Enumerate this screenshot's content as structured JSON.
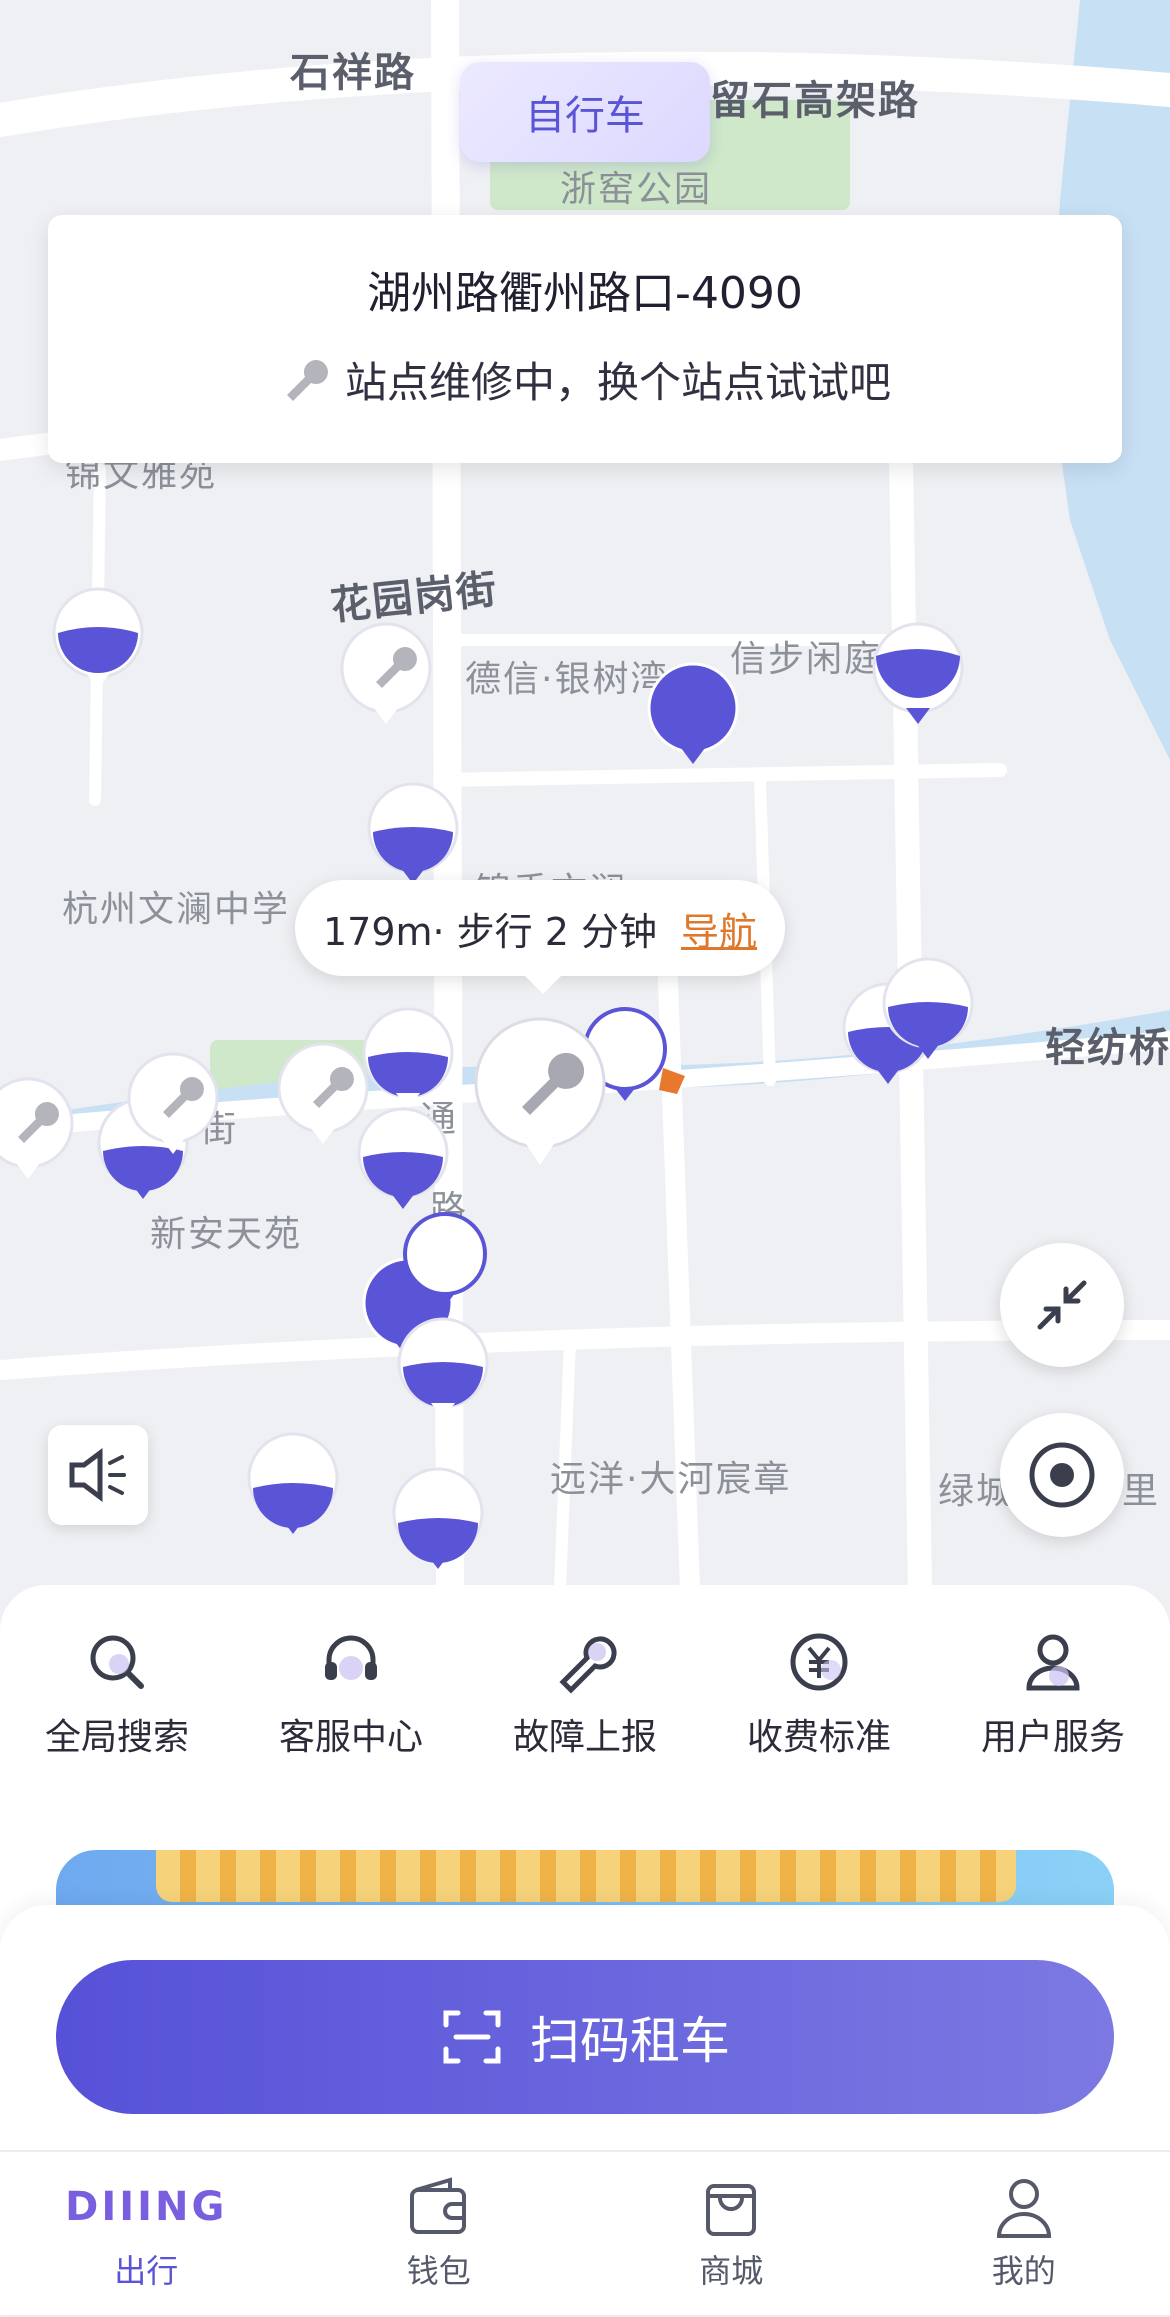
{
  "map": {
    "labels": [
      "石祥路",
      "留石高架路",
      "浙窑公园",
      "锦文雅苑",
      "花园岗街",
      "德信·银树湾",
      "信步闲庭",
      "杭州文澜中学",
      "锦秀文澜",
      "轻纺桥",
      "新安天苑",
      "远洋·大河宸章",
      "绿城",
      "里",
      "街",
      "通",
      "路"
    ]
  },
  "mode_toggle": "自行车",
  "station_card": {
    "title": "湖州路衢州路口-4090",
    "status": "站点维修中，换个站点试试吧"
  },
  "walk_bubble": {
    "distance_text": "179m· 步行 2 分钟",
    "nav_label": "导航"
  },
  "quick_actions": [
    {
      "label": "全局搜索",
      "icon": "search-icon"
    },
    {
      "label": "客服中心",
      "icon": "headset-icon"
    },
    {
      "label": "故障上报",
      "icon": "wrench-icon"
    },
    {
      "label": "收费标准",
      "icon": "yuan-icon"
    },
    {
      "label": "用户服务",
      "icon": "user-icon"
    }
  ],
  "scan_button": "扫码租车",
  "tabs": [
    {
      "label": "出行",
      "logo": "DIIING",
      "active": true,
      "icon": "logo-icon"
    },
    {
      "label": "钱包",
      "active": false,
      "icon": "wallet-icon"
    },
    {
      "label": "商城",
      "active": false,
      "icon": "shopping-bag-icon"
    },
    {
      "label": "我的",
      "active": false,
      "icon": "profile-icon"
    }
  ],
  "colors": {
    "accent": "#5a55d6",
    "nav_link": "#e0782c",
    "water": "#c8e0f4",
    "park": "#cfe8c9"
  }
}
